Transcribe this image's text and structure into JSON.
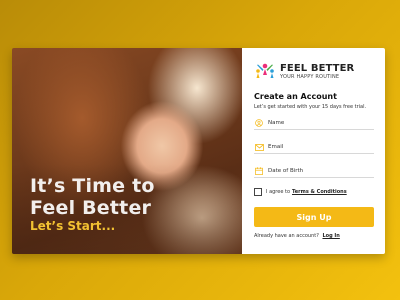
{
  "hero": {
    "title_line1": "It’s Time to",
    "title_line2": "Feel Better",
    "subtitle": "Let’s Start..."
  },
  "brand": {
    "name": "FEEL BETTER",
    "tagline": "YOUR HAPPY ROUTINE",
    "logo_icon": "people-celebrating-icon",
    "logo_colors": [
      "#2b9fd9",
      "#ec2e7a",
      "#f4b916",
      "#4cae4c"
    ]
  },
  "form": {
    "title": "Create an Account",
    "subtitle": "Let’s get started with your 15 days free trial.",
    "fields": [
      {
        "icon": "user-icon",
        "placeholder": "Name"
      },
      {
        "icon": "mail-icon",
        "placeholder": "Email"
      },
      {
        "icon": "calendar-icon",
        "placeholder": "Date of Birth"
      }
    ],
    "agree_text": "I agree to",
    "terms_link": "Terms & Conditions",
    "signup_label": "Sign Up",
    "login_prompt": "Already have an account?",
    "login_link": "Log In"
  },
  "colors": {
    "accent": "#f4b916",
    "background_gradient": [
      "#b98c08",
      "#f3c10e"
    ],
    "hero_subtitle": "#f2c232"
  }
}
